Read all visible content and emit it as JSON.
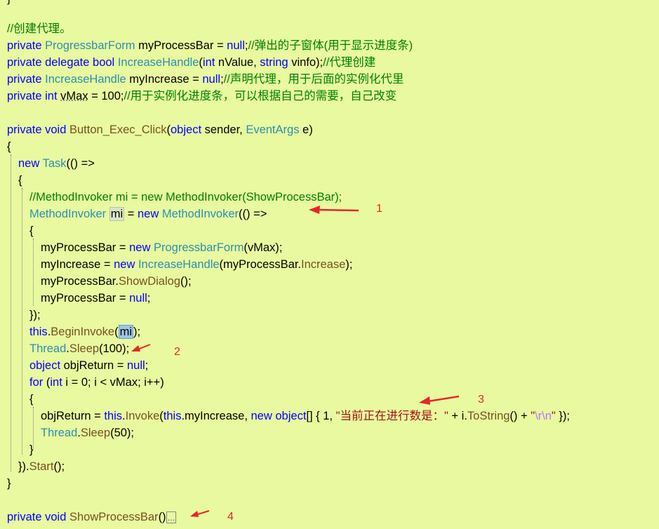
{
  "top_brace": "}",
  "lines": {
    "l1": "//创建代理。",
    "l2": {
      "k1": "private",
      "t1": "ProgressbarForm",
      "v1": " myProcessBar = ",
      "k2": "null",
      "p1": ";",
      "c1": "//弹出的子窗体(用于显示进度条)"
    },
    "l3": {
      "k1": "private",
      "k2": "delegate",
      "k3": "bool",
      "t1": "IncreaseHandle",
      "p1": "(",
      "k4": "int",
      "v1": " nValue, ",
      "k5": "string",
      "v2": " vinfo);",
      "c1": "//代理创建"
    },
    "l4": {
      "k1": "private",
      "t1": "IncreaseHandle",
      "v1": " myIncrease = ",
      "k2": "null",
      "p1": ";",
      "c1": "//声明代理，用于后面的实例化代里"
    },
    "l5": {
      "k1": "private",
      "k2": "int",
      "v1a": "vMax",
      "v1b": " = 100;",
      "c1": "//用于实例化进度条，可以根据自己的需要，自己改变"
    },
    "l6": {
      "k1": "private",
      "k2": "void",
      "m1": "Button_Exec_Click",
      "p1": "(",
      "k3": "object",
      "v1": " sender, ",
      "t1": "EventArgs",
      "v2": " e)"
    },
    "l7": "{",
    "l8": {
      "k1": "new",
      "t1": "Task",
      "v1": "(() =>"
    },
    "l9": "{",
    "l10": "//MethodInvoker mi = new MethodInvoker(ShowProcessBar);",
    "l11": {
      "t1": "MethodInvoker",
      "hl": "mi",
      "v1": " = ",
      "k1": "new",
      "t2": "MethodInvoker",
      "v2": "(() =>"
    },
    "l12": "{",
    "l13": {
      "v1": "myProcessBar = ",
      "k1": "new",
      "t1": "ProgressbarForm",
      "v2": "(vMax);"
    },
    "l14": {
      "v1": "myIncrease = ",
      "k1": "new",
      "t1": "IncreaseHandle",
      "v2": "(myProcessBar.",
      "m1": "Increase",
      "v3": ");"
    },
    "l15": {
      "v1": "myProcessBar.",
      "m1": "ShowDialog",
      "v2": "();"
    },
    "l16": {
      "v1": "myProcessBar = ",
      "k1": "null",
      "v2": ";"
    },
    "l17": "});",
    "l18": {
      "k1": "this",
      "p1": ".",
      "m1": "BeginInvoke",
      "p2": "(",
      "sel": "mi",
      "p3": ");"
    },
    "l19": {
      "t1": "Thread",
      "p1": ".",
      "m1": "Sleep",
      "v1": "(100);"
    },
    "l20": {
      "k1": "object",
      "v1": " objReturn = ",
      "k2": "null",
      "v2": ";"
    },
    "l21": {
      "k1": "for",
      "p1": " (",
      "k2": "int",
      "v1": " i = 0; i < vMax; i++)"
    },
    "l22": "{",
    "l23": {
      "v1": "objReturn = ",
      "k1": "this",
      "p1": ".",
      "m1": "Invoke",
      "p2": "(",
      "k2": "this",
      "v2": ".myIncrease, ",
      "k3": "new",
      "k4": "object",
      "v3": "[] { 1, ",
      "s1": "\"当前正在进行数是：\"",
      "v4": " + i.",
      "m2": "ToString",
      "v5": "() + ",
      "s2a": "\"",
      "esc": "\\r\\n",
      "s2b": "\"",
      "v6": " });"
    },
    "l24": {
      "t1": "Thread",
      "p1": ".",
      "m1": "Sleep",
      "v1": "(50);"
    },
    "l25": "}",
    "l26": {
      "v1": "}).",
      "m1": "Start",
      "v2": "();"
    },
    "l27": "}",
    "l28": {
      "k1": "private",
      "k2": "void",
      "m1": "ShowProcessBar",
      "v1": "()",
      "fold": "..."
    }
  },
  "annotations": [
    "1",
    "2",
    "3",
    "4"
  ],
  "colors": {
    "background": "#e8f9a0",
    "keyword": "#0000ff",
    "type": "#2b91af",
    "comment": "#008000",
    "string": "#a31515",
    "method": "#74531f",
    "annotation": "#e0282c"
  }
}
